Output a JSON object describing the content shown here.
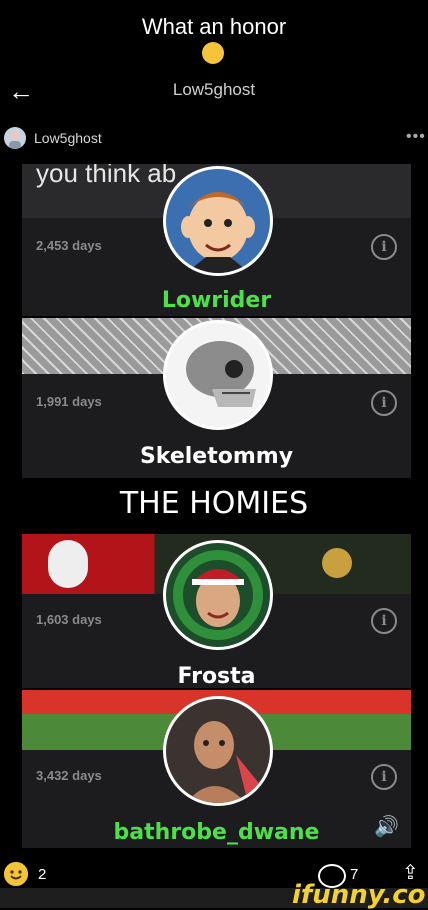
{
  "header": {
    "title": "What an honor",
    "title_emoji": "pleading-face-icon",
    "username": "Low5ghost"
  },
  "post": {
    "username": "Low5ghost",
    "more": "•••",
    "caption_fragment": "you think ab",
    "section_title": "THE HOMIES"
  },
  "cards": [
    {
      "days": "2,453 days",
      "name": "Lowrider",
      "name_color": "#4ee04a"
    },
    {
      "days": "1,991 days",
      "name": "Skeletommy",
      "name_color": "#ffffff"
    },
    {
      "days": "1,603 days",
      "name": "Frosta",
      "name_color": "#ffffff"
    },
    {
      "days": "3,432 days",
      "name": "bathrobe_dwane",
      "name_color": "#4ee04a"
    }
  ],
  "footer": {
    "smile_count": "2",
    "comment_count": "7",
    "brand": "ifunny.co",
    "brand_color": "#f4d12d"
  },
  "icons": {
    "back": "←",
    "info": "i",
    "share": "⇪",
    "speaker": "🔊"
  }
}
